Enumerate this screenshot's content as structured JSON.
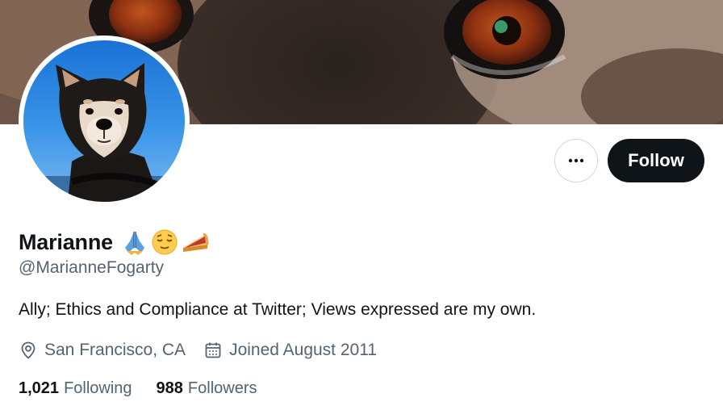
{
  "profile": {
    "display_name": "Marianne",
    "name_emojis": [
      "folded-hands-emoji",
      "relieved-face-emoji",
      "pie-emoji"
    ],
    "handle": "@MarianneFogarty",
    "bio": "Ally; Ethics and Compliance at Twitter; Views expressed are my own.",
    "location": "San Francisco, CA",
    "joined": "Joined August 2011"
  },
  "actions": {
    "follow_label": "Follow",
    "more_icon": "more-horizontal-icon"
  },
  "stats": {
    "following_count": "1,021",
    "following_label": "Following",
    "followers_count": "988",
    "followers_label": "Followers"
  },
  "colors": {
    "primary_text": "#0f1419",
    "secondary_text": "#536471",
    "follow_button_bg": "#0f1419",
    "border": "#cfd9de"
  }
}
